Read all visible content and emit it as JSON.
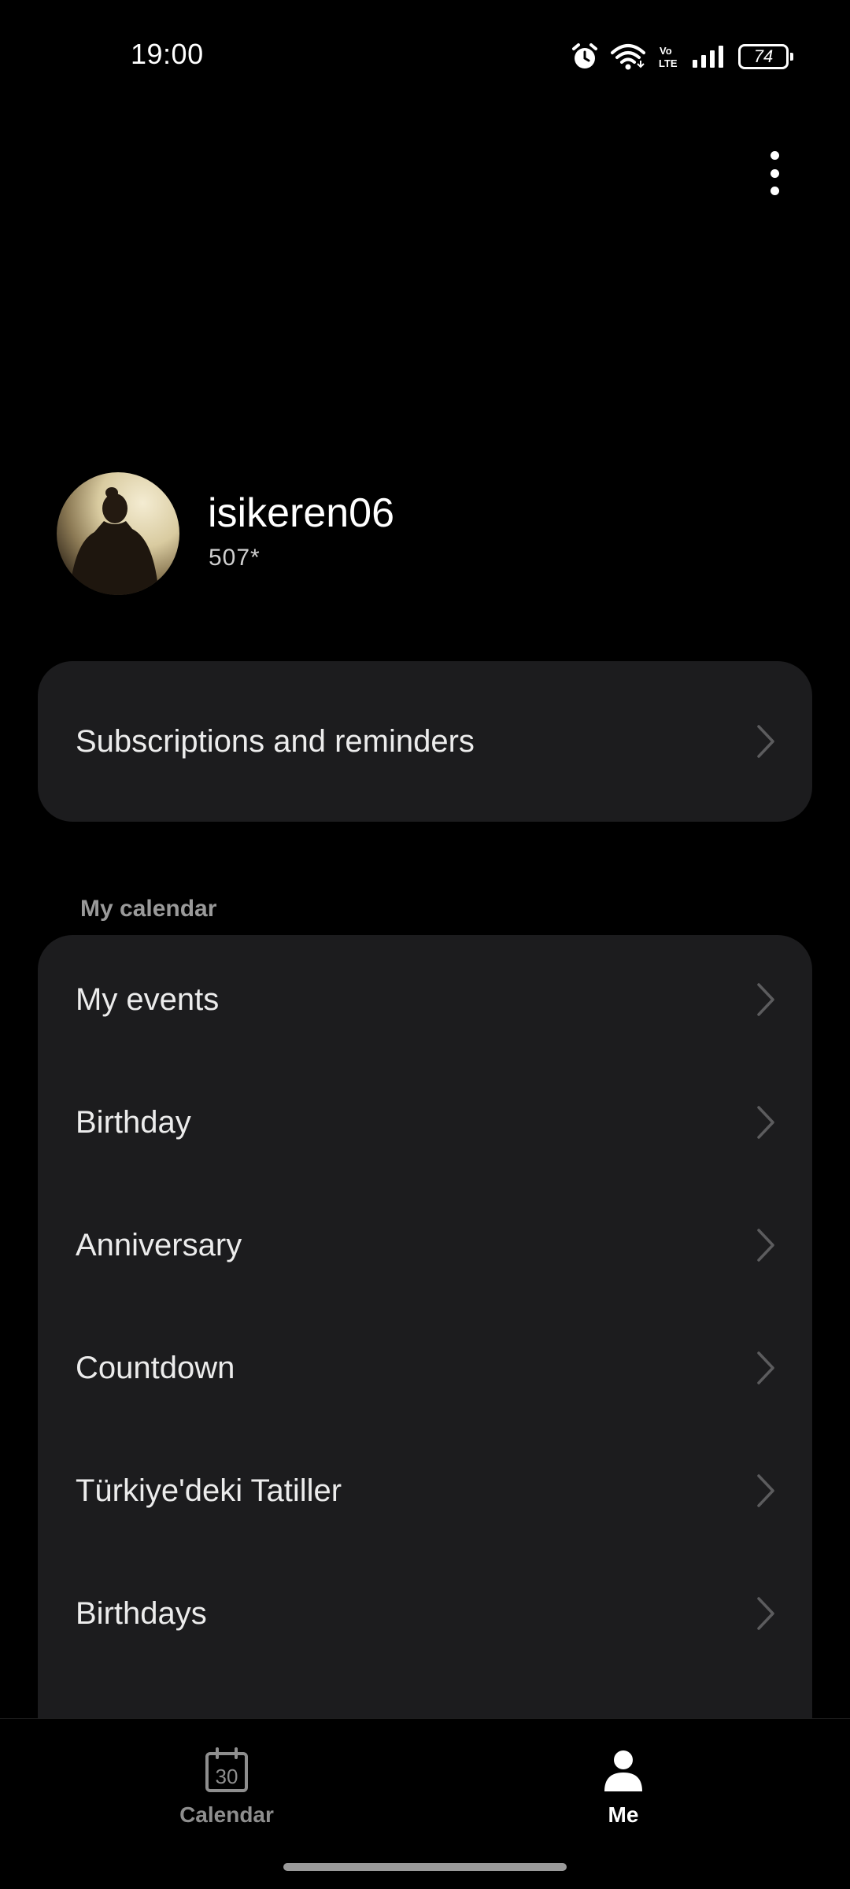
{
  "status_bar": {
    "time": "19:00",
    "battery": "74",
    "icons": [
      "alarm-icon",
      "wifi-icon",
      "volte-icon",
      "signal-icon",
      "battery-icon"
    ]
  },
  "header": {
    "more_icon": "more-vertical-icon"
  },
  "profile": {
    "username": "isikeren06",
    "phone": "507*"
  },
  "subscriptions": {
    "label": "Subscriptions and reminders"
  },
  "my_calendar": {
    "title": "My calendar",
    "items": [
      {
        "label": "My events"
      },
      {
        "label": "Birthday"
      },
      {
        "label": "Anniversary"
      },
      {
        "label": "Countdown"
      },
      {
        "label": "Türkiye'deki Tatiller"
      },
      {
        "label": "Birthdays"
      }
    ]
  },
  "bottom_nav": {
    "calendar": {
      "label": "Calendar",
      "icon": "calendar-icon",
      "icon_text": "30"
    },
    "me": {
      "label": "Me",
      "icon": "person-icon",
      "active": true
    }
  },
  "colors": {
    "background": "#000000",
    "card": "#1c1c1e",
    "text_primary": "#ececec",
    "text_muted": "#9a9a9a"
  }
}
